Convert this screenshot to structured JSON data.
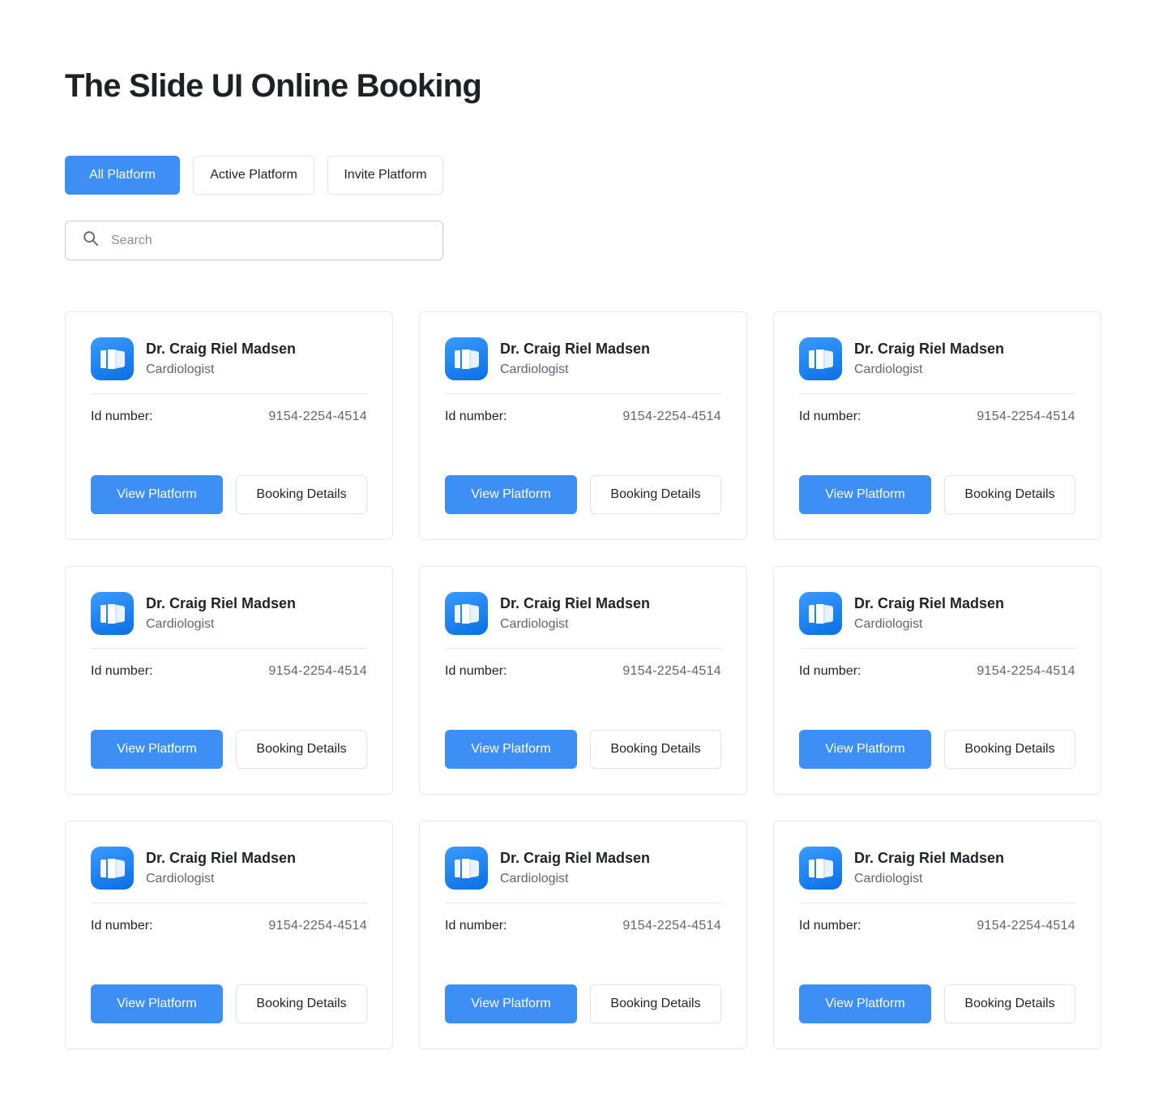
{
  "page": {
    "title": "The Slide UI Online Booking"
  },
  "tabs": [
    {
      "label": "All Platform",
      "active": true
    },
    {
      "label": "Active Platform",
      "active": false
    },
    {
      "label": "Invite Platform",
      "active": false
    }
  ],
  "search": {
    "placeholder": "Search",
    "value": "",
    "icon": "search-icon"
  },
  "colors": {
    "accent": "#3d8ef5",
    "logo": "#1a7cf0"
  },
  "cards": [
    {
      "logo_icon": "platform-logo-icon",
      "name": "Dr. Craig Riel Madsen",
      "role": "Cardiologist",
      "id_label": "Id number:",
      "id_value": "9154-2254-4514",
      "primary_label": "View Platform",
      "secondary_label": "Booking Details"
    },
    {
      "logo_icon": "platform-logo-icon",
      "name": "Dr. Craig Riel Madsen",
      "role": "Cardiologist",
      "id_label": "Id number:",
      "id_value": "9154-2254-4514",
      "primary_label": "View Platform",
      "secondary_label": "Booking Details"
    },
    {
      "logo_icon": "platform-logo-icon",
      "name": "Dr. Craig Riel Madsen",
      "role": "Cardiologist",
      "id_label": "Id number:",
      "id_value": "9154-2254-4514",
      "primary_label": "View Platform",
      "secondary_label": "Booking Details"
    },
    {
      "logo_icon": "platform-logo-icon",
      "name": "Dr. Craig Riel Madsen",
      "role": "Cardiologist",
      "id_label": "Id number:",
      "id_value": "9154-2254-4514",
      "primary_label": "View Platform",
      "secondary_label": "Booking Details"
    },
    {
      "logo_icon": "platform-logo-icon",
      "name": "Dr. Craig Riel Madsen",
      "role": "Cardiologist",
      "id_label": "Id number:",
      "id_value": "9154-2254-4514",
      "primary_label": "View Platform",
      "secondary_label": "Booking Details"
    },
    {
      "logo_icon": "platform-logo-icon",
      "name": "Dr. Craig Riel Madsen",
      "role": "Cardiologist",
      "id_label": "Id number:",
      "id_value": "9154-2254-4514",
      "primary_label": "View Platform",
      "secondary_label": "Booking Details"
    },
    {
      "logo_icon": "platform-logo-icon",
      "name": "Dr. Craig Riel Madsen",
      "role": "Cardiologist",
      "id_label": "Id number:",
      "id_value": "9154-2254-4514",
      "primary_label": "View Platform",
      "secondary_label": "Booking Details"
    },
    {
      "logo_icon": "platform-logo-icon",
      "name": "Dr. Craig Riel Madsen",
      "role": "Cardiologist",
      "id_label": "Id number:",
      "id_value": "9154-2254-4514",
      "primary_label": "View Platform",
      "secondary_label": "Booking Details"
    },
    {
      "logo_icon": "platform-logo-icon",
      "name": "Dr. Craig Riel Madsen",
      "role": "Cardiologist",
      "id_label": "Id number:",
      "id_value": "9154-2254-4514",
      "primary_label": "View Platform",
      "secondary_label": "Booking Details"
    }
  ]
}
